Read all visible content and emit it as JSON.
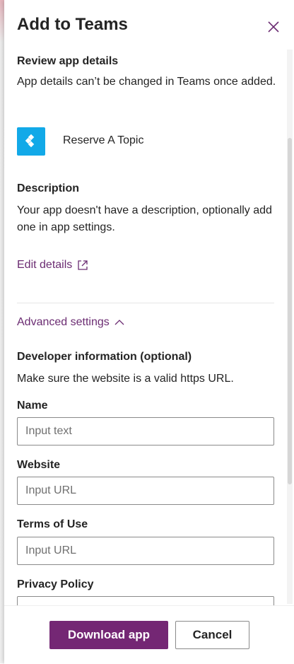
{
  "panel": {
    "title": "Add to Teams",
    "close_icon": "close-icon"
  },
  "review": {
    "heading": "Review app details",
    "text": "App details can’t be changed in Teams once added."
  },
  "app": {
    "name": "Reserve A Topic",
    "tile_color": "#12a9e8",
    "icon": "power-apps-diamond-icon"
  },
  "description": {
    "heading": "Description",
    "text": "Your app doesn't have a description, optionally add one in app settings."
  },
  "edit_details": {
    "label": "Edit details",
    "icon": "external-link-icon"
  },
  "advanced": {
    "label": "Advanced settings",
    "icon": "chevron-up-icon",
    "expanded": true
  },
  "developer": {
    "heading": "Developer information (optional)",
    "hint": "Make sure the website is a valid https URL."
  },
  "fields": {
    "name": {
      "label": "Name",
      "placeholder": "Input text",
      "value": ""
    },
    "website": {
      "label": "Website",
      "placeholder": "Input URL",
      "value": ""
    },
    "terms": {
      "label": "Terms of Use",
      "placeholder": "Input URL",
      "value": ""
    },
    "privacy": {
      "label": "Privacy Policy",
      "placeholder": "",
      "value": ""
    }
  },
  "footer": {
    "primary_label": "Download app",
    "secondary_label": "Cancel"
  },
  "colors": {
    "accent": "#742774",
    "link": "#6b2c72"
  }
}
